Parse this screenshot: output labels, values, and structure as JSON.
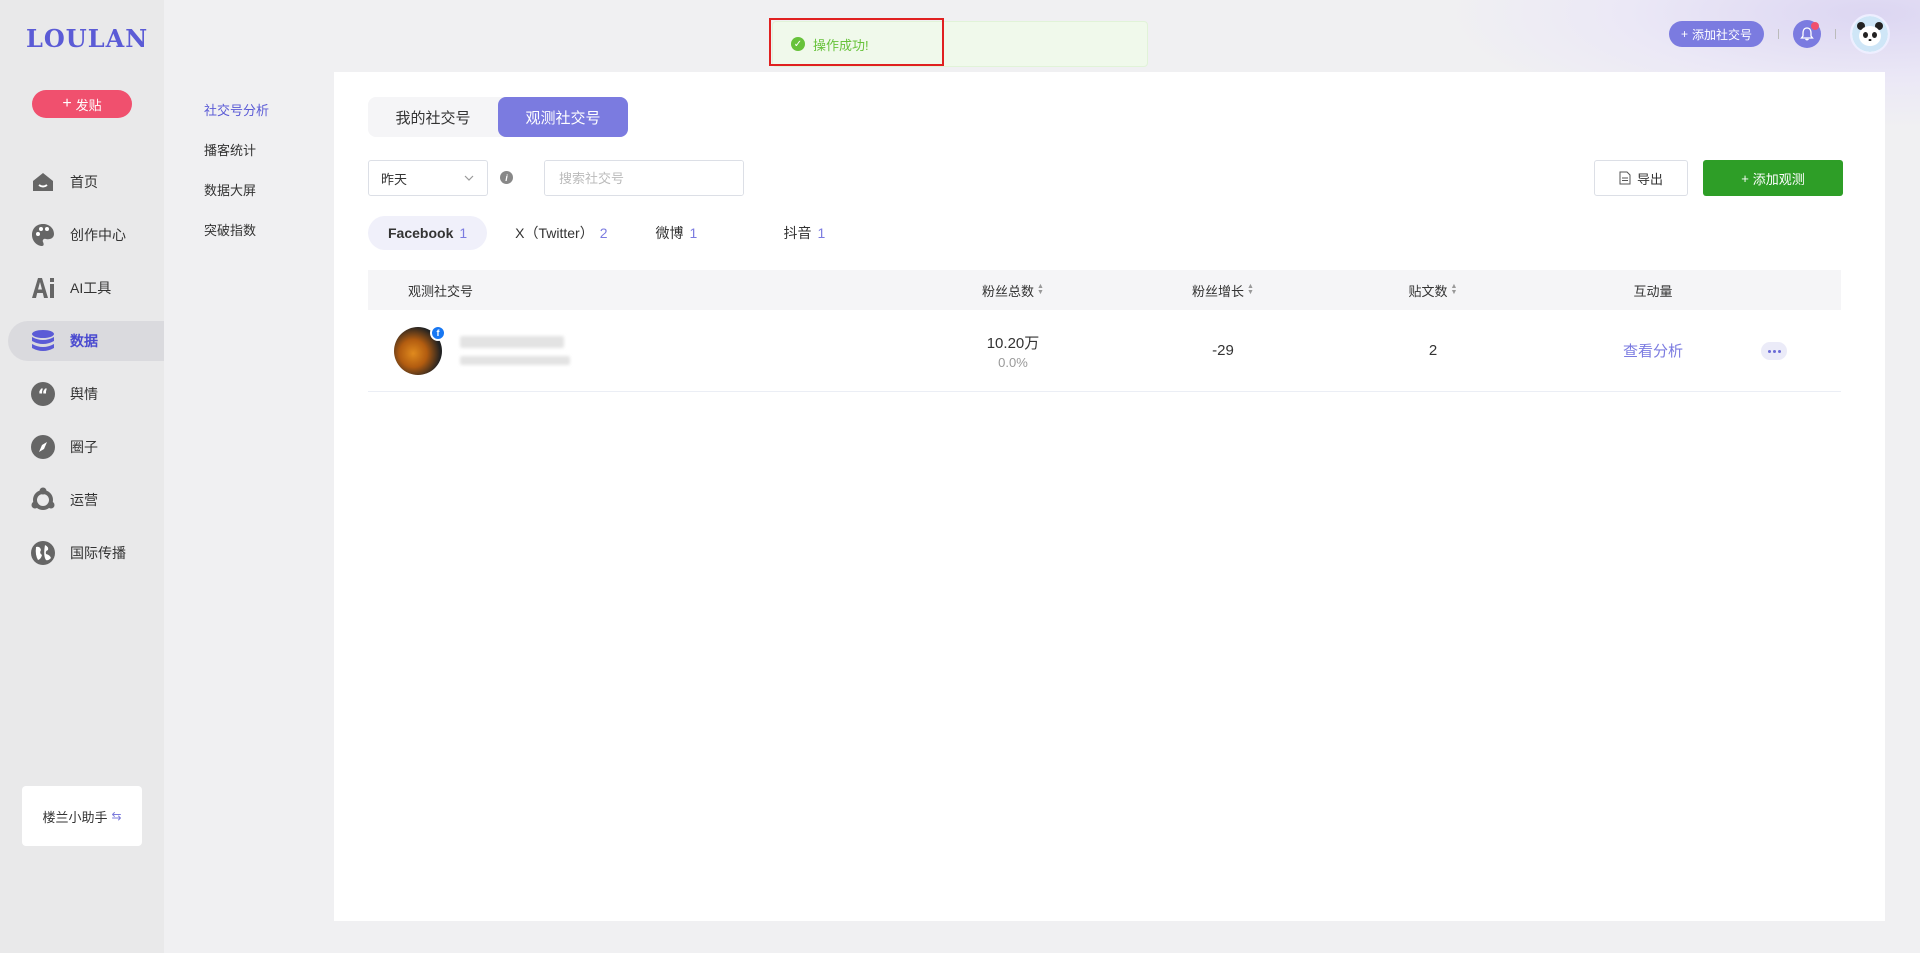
{
  "app": {
    "logo": "LOULAN"
  },
  "sidebar": {
    "post_label": "发贴",
    "items": [
      {
        "label": "首页",
        "icon": "home-icon"
      },
      {
        "label": "创作中心",
        "icon": "palette-icon"
      },
      {
        "label": "AI工具",
        "icon": "ai-icon"
      },
      {
        "label": "数据",
        "icon": "database-icon",
        "active": true
      },
      {
        "label": "舆情",
        "icon": "quote-icon"
      },
      {
        "label": "圈子",
        "icon": "compass-icon"
      },
      {
        "label": "运营",
        "icon": "operations-icon"
      },
      {
        "label": "国际传播",
        "icon": "globe-icon"
      }
    ],
    "helper_label": "楼兰小助手"
  },
  "subnav": {
    "items": [
      {
        "label": "社交号分析",
        "active": true
      },
      {
        "label": "播客统计"
      },
      {
        "label": "数据大屏"
      },
      {
        "label": "突破指数"
      }
    ]
  },
  "topbar": {
    "add_social_label": "添加社交号"
  },
  "toast": {
    "message": "操作成功!"
  },
  "tabs": [
    {
      "label": "我的社交号"
    },
    {
      "label": "观测社交号",
      "active": true
    }
  ],
  "filters": {
    "date_value": "昨天",
    "search_placeholder": "搜索社交号",
    "export_label": "导出",
    "add_watch_label": "添加观测"
  },
  "platforms": [
    {
      "name": "Facebook",
      "count": "1",
      "active": true
    },
    {
      "name": "X（Twitter）",
      "count": "2"
    },
    {
      "name": "微博",
      "count": "1"
    },
    {
      "name": "抖音",
      "count": "1"
    }
  ],
  "table": {
    "headers": {
      "account": "观测社交号",
      "fans": "粉丝总数",
      "growth": "粉丝增长",
      "posts": "贴文数",
      "interactions": "互动量"
    },
    "rows": [
      {
        "fans_total": "10.20万",
        "fans_pct": "0.0%",
        "growth": "-29",
        "posts": "2",
        "action": "查看分析"
      }
    ]
  },
  "colors": {
    "accent": "#7b7be0",
    "post_button": "#f0506e",
    "add_watch": "#2e9e27",
    "success": "#67c23a",
    "highlight": "#e02020"
  }
}
